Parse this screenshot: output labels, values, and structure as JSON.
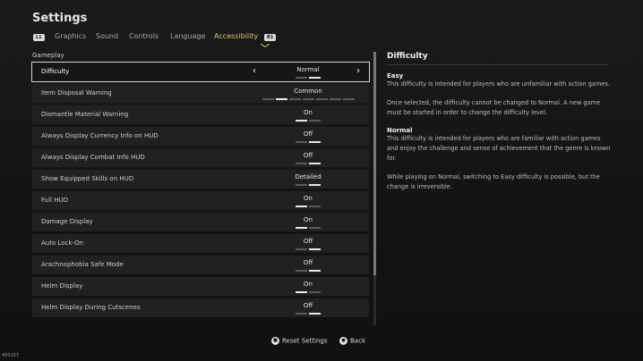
{
  "header": {
    "title": "Settings"
  },
  "tabs": {
    "left_hint": "L1",
    "right_hint": "R1",
    "items": [
      {
        "label": "Graphics"
      },
      {
        "label": "Sound"
      },
      {
        "label": "Controls"
      },
      {
        "label": "Language"
      },
      {
        "label": "Accessibility"
      }
    ],
    "active": "Accessibility"
  },
  "section": {
    "label": "Gameplay"
  },
  "settings": [
    {
      "label": "Difficulty",
      "value": "Normal",
      "selected": true,
      "options_count": 2,
      "option_index": 1
    },
    {
      "label": "Item Disposal Warning",
      "value": "Common",
      "options_count": 7,
      "option_index": 1
    },
    {
      "label": "Dismantle Material Warning",
      "value": "On",
      "options_count": 2,
      "option_index": 0
    },
    {
      "label": "Always Display Currency Info on HUD",
      "value": "Off",
      "options_count": 2,
      "option_index": 1
    },
    {
      "label": "Always Display Combat Info HUD",
      "value": "Off",
      "options_count": 2,
      "option_index": 1
    },
    {
      "label": "Show Equipped Skills on HUD",
      "value": "Detailed",
      "options_count": 2,
      "option_index": 1
    },
    {
      "label": "Full HUD",
      "value": "On",
      "options_count": 2,
      "option_index": 0
    },
    {
      "label": "Damage Display",
      "value": "On",
      "options_count": 2,
      "option_index": 0
    },
    {
      "label": "Auto Lock-On",
      "value": "Off",
      "options_count": 2,
      "option_index": 1
    },
    {
      "label": "Arachnophobia Safe Mode",
      "value": "Off",
      "options_count": 2,
      "option_index": 1
    },
    {
      "label": "Helm Display",
      "value": "On",
      "options_count": 2,
      "option_index": 0
    },
    {
      "label": "Helm Display During Cutscenes",
      "value": "Off",
      "options_count": 2,
      "option_index": 1
    }
  ],
  "panel": {
    "title": "Difficulty",
    "easy_heading": "Easy",
    "easy_text_1": "This difficulty is intended for players who are unfamiliar with action games.",
    "easy_text_2": "Once selected, the difficulty cannot be changed to Normal. A new game must be started in order to change the difficulty level.",
    "normal_heading": "Normal",
    "normal_text_1": "This difficulty is intended for players who are familiar with action games and enjoy the challenge and sense of achievement that the genre is known for.",
    "normal_text_2": "While playing on Normal, switching to Easy difficulty is possible, but the change is irreversible."
  },
  "footer": {
    "reset_label": "Reset Settings",
    "back_label": "Back"
  },
  "uid": "450157"
}
